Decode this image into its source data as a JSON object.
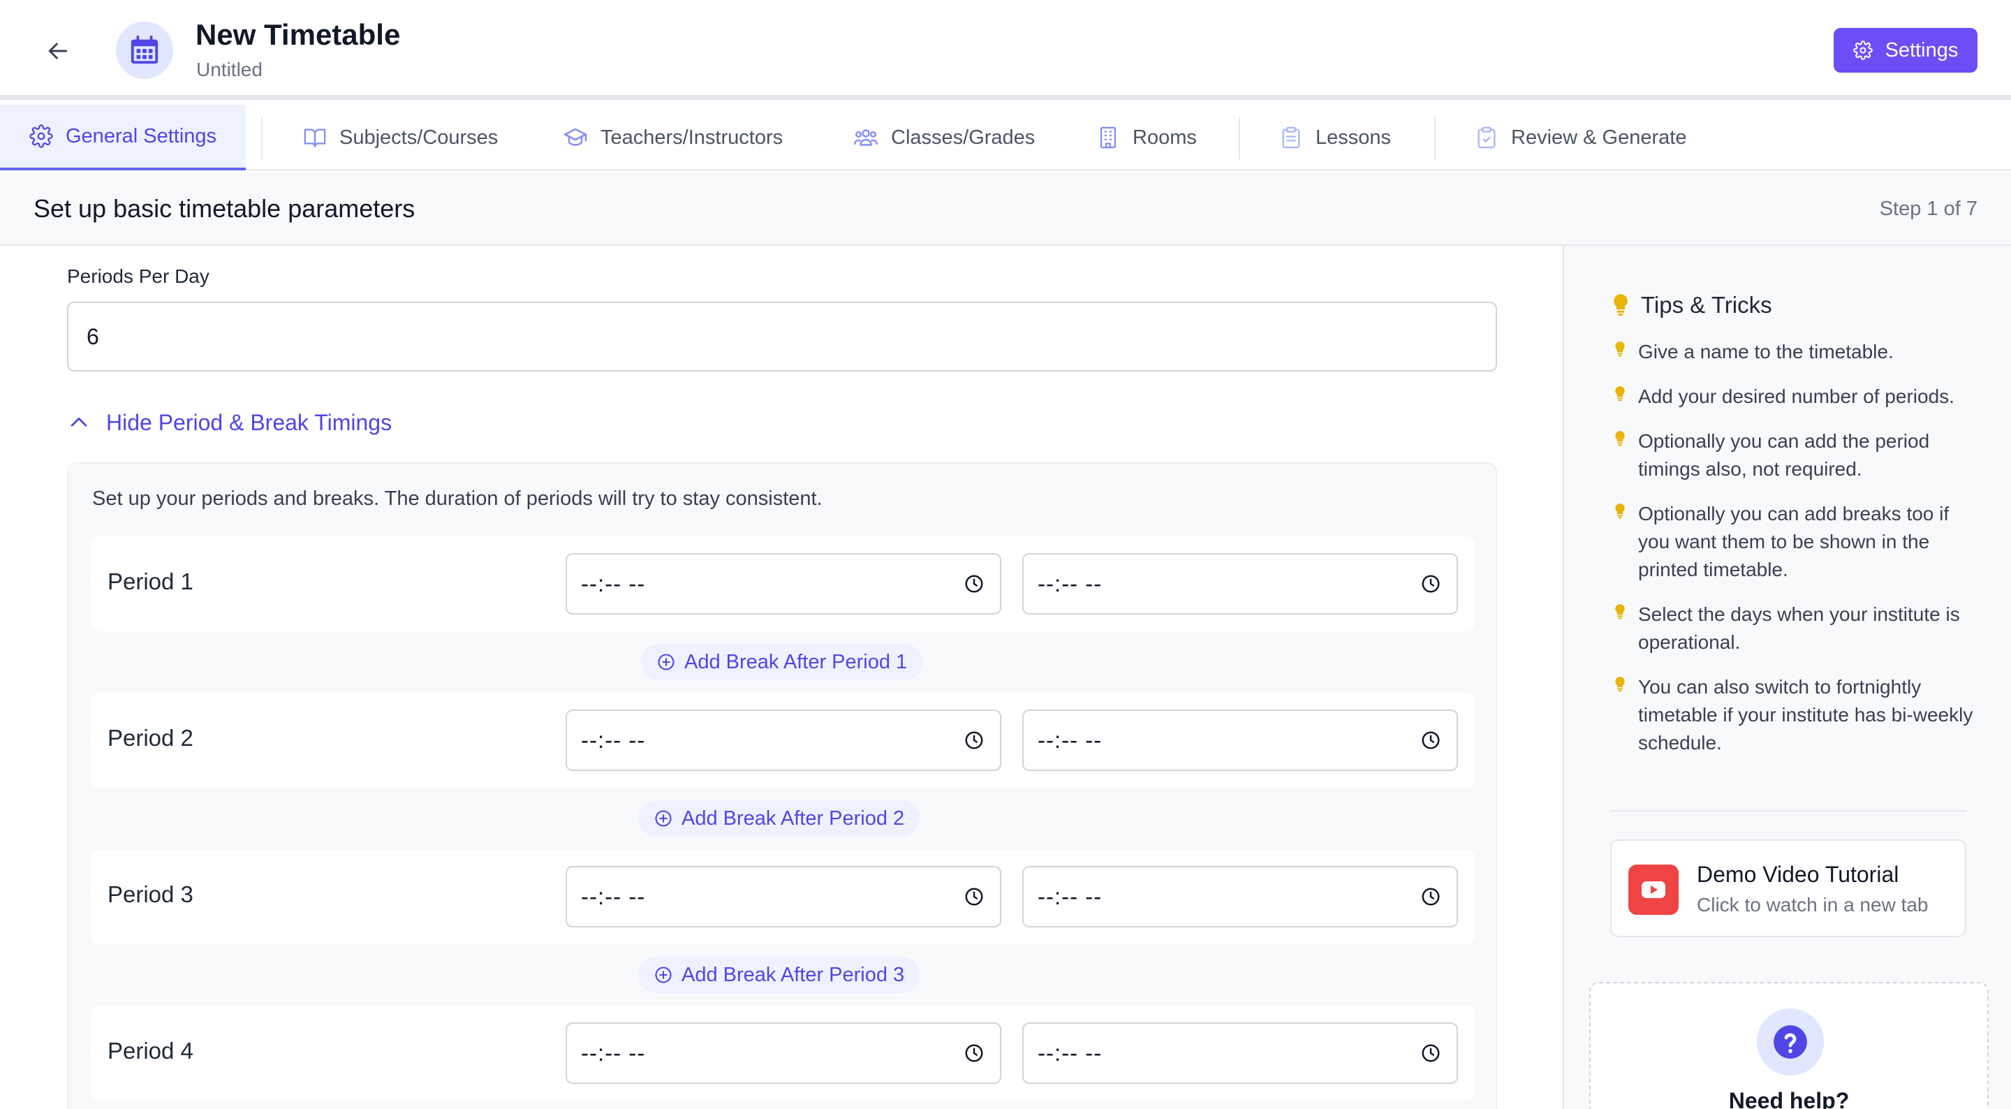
{
  "header": {
    "title": "New Timetable",
    "subtitle": "Untitled",
    "settings_label": "Settings"
  },
  "tabs": [
    {
      "label": "General Settings",
      "icon": "gear-icon",
      "active": true
    },
    {
      "label": "Subjects/Courses",
      "icon": "book-icon"
    },
    {
      "label": "Teachers/Instructors",
      "icon": "graduation-cap-icon"
    },
    {
      "label": "Classes/Grades",
      "icon": "users-icon"
    },
    {
      "label": "Rooms",
      "icon": "building-icon"
    },
    {
      "label": "Lessons",
      "icon": "clipboard-icon"
    },
    {
      "label": "Review & Generate",
      "icon": "clipboard-check-icon"
    }
  ],
  "step": {
    "title": "Set up basic timetable parameters",
    "counter": "Step 1 of 7"
  },
  "form": {
    "periods_label": "Periods Per Day",
    "periods_value": "6",
    "toggle_label": "Hide Period & Break Timings",
    "panel_description": "Set up your periods and breaks. The duration of periods will try to stay consistent.",
    "time_placeholder": "--:-- --",
    "periods": [
      {
        "label": "Period 1",
        "add_break": "Add Break After Period 1"
      },
      {
        "label": "Period 2",
        "add_break": "Add Break After Period 2"
      },
      {
        "label": "Period 3",
        "add_break": "Add Break After Period 3"
      },
      {
        "label": "Period 4"
      }
    ]
  },
  "sidebar": {
    "tips_title": "Tips & Tricks",
    "tips": [
      "Give a name to the timetable.",
      "Add your desired number of periods.",
      "Optionally you can add the period timings also, not required.",
      "Optionally you can add breaks too if you want them to be shown in the printed timetable.",
      "Select the days when your institute is operational.",
      "You can also switch to fortnightly timetable if your institute has bi-weekly schedule."
    ],
    "video": {
      "title": "Demo Video Tutorial",
      "subtitle": "Click to watch in a new tab"
    },
    "help_title": "Need help?"
  },
  "colors": {
    "accent": "#6d4ef6",
    "accent_text": "#4f46e5",
    "tab_active_bg": "#eef2ff",
    "tip_bulb": "#eab308",
    "youtube": "#ef4444"
  }
}
